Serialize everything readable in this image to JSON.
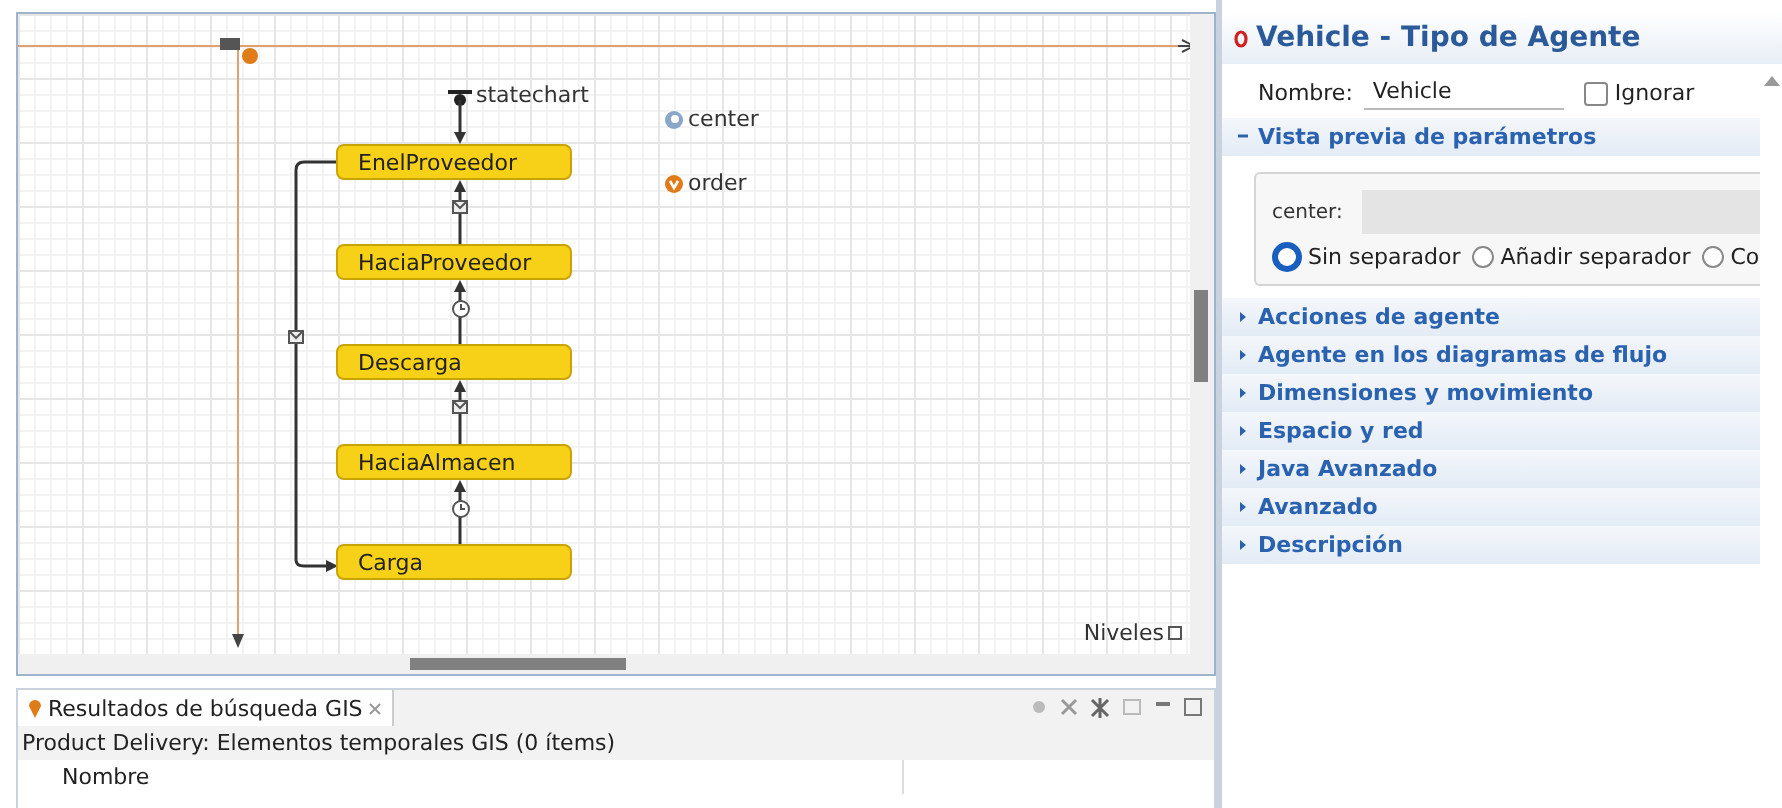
{
  "canvas": {
    "states": [
      {
        "name": "EnelProveedor"
      },
      {
        "name": "HaciaProveedor"
      },
      {
        "name": "Descarga"
      },
      {
        "name": "HaciaAlmacen"
      },
      {
        "name": "Carga"
      }
    ],
    "transitions": [
      {
        "kind": "message"
      },
      {
        "kind": "timeout"
      },
      {
        "kind": "message"
      },
      {
        "kind": "timeout"
      }
    ],
    "loop_transition": {
      "kind": "message"
    },
    "statechart_label": "statechart",
    "elements": [
      {
        "kind": "parameter",
        "label": "center"
      },
      {
        "kind": "variable",
        "label": "order"
      }
    ],
    "levels_label": "Niveles"
  },
  "bottom_panel": {
    "tab": {
      "label": "Resultados de búsqueda GIS",
      "selected": true
    },
    "summary": "Product Delivery: Elementos temporales GIS (0 ítems)",
    "columns": [
      "Nombre"
    ]
  },
  "properties": {
    "title": "Vehicle - Tipo de Agente",
    "name_label": "Nombre:",
    "name_value": "Vehicle",
    "ignore": {
      "label": "Ignorar",
      "checked": false
    },
    "sections": [
      {
        "label": "Vista previa de parámetros",
        "expanded": true,
        "field_label": "center:",
        "radios": [
          {
            "label": "Sin separador",
            "selected": true
          },
          {
            "label": "Añadir separador",
            "selected": false
          },
          {
            "label": "Co",
            "selected": false
          }
        ]
      },
      {
        "label": "Acciones de agente",
        "expanded": false
      },
      {
        "label": "Agente en los diagramas de flujo",
        "expanded": false
      },
      {
        "label": "Dimensiones y movimiento",
        "expanded": false
      },
      {
        "label": "Espacio y red",
        "expanded": false
      },
      {
        "label": "Java Avanzado",
        "expanded": false
      },
      {
        "label": "Avanzado",
        "expanded": false
      },
      {
        "label": "Descripción",
        "expanded": false
      }
    ]
  }
}
